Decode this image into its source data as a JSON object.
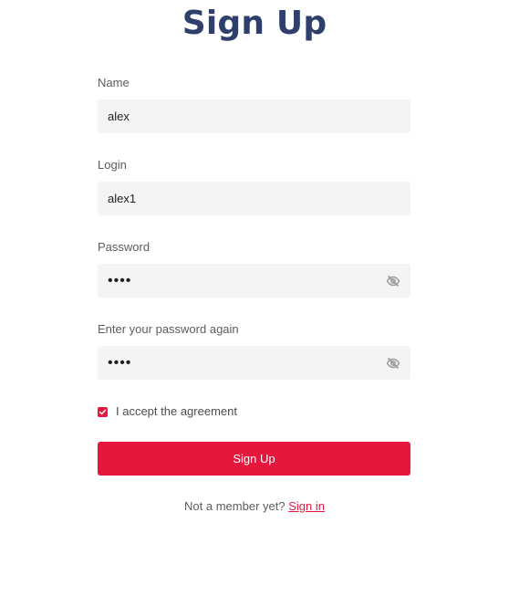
{
  "page": {
    "title": "Sign Up"
  },
  "form": {
    "name": {
      "label": "Name",
      "value": "alex"
    },
    "login": {
      "label": "Login",
      "value": "alex1"
    },
    "password": {
      "label": "Password",
      "value": "••••",
      "toggle_icon": "eye-off-icon"
    },
    "password_confirm": {
      "label": "Enter your password again",
      "value": "••••",
      "toggle_icon": "eye-off-icon"
    },
    "agreement": {
      "label": "I accept the agreement",
      "checked": true
    },
    "submit_label": "Sign Up"
  },
  "footer": {
    "prompt": "Not a member yet?",
    "link_label": "Sign in"
  },
  "colors": {
    "title": "#2e3f6b",
    "accent": "#e5173d",
    "field_bg": "#f4f4f4"
  }
}
